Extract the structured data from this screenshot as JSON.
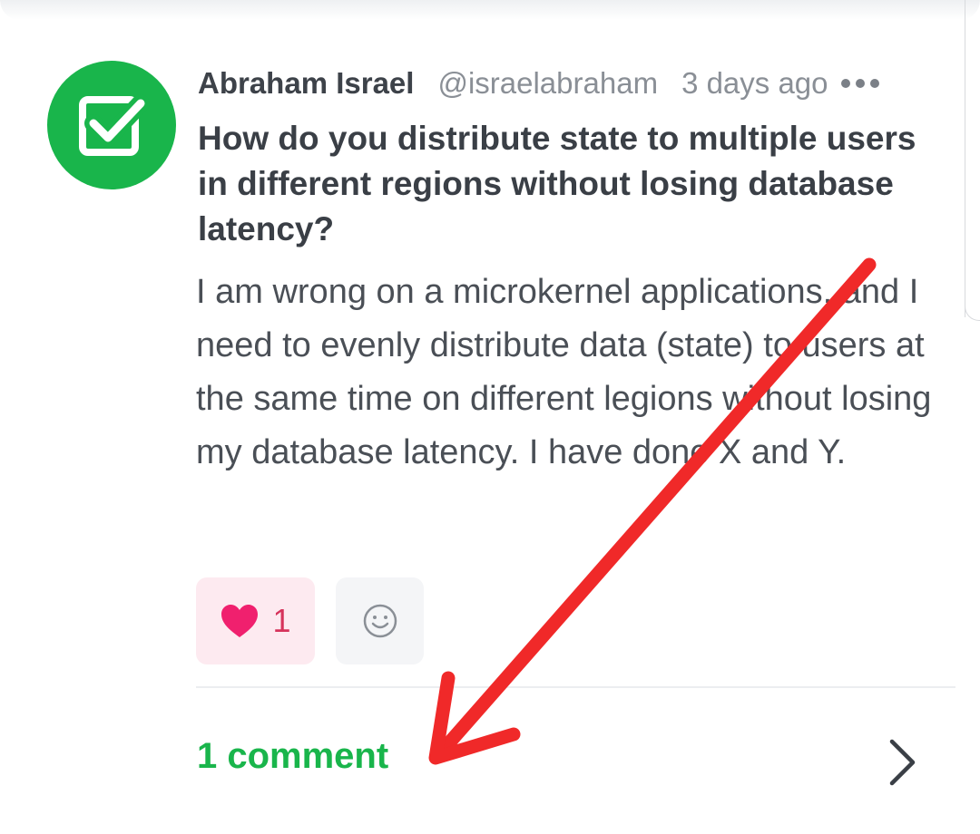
{
  "post": {
    "author_name": "Abraham Israel",
    "author_handle": "@israelabraham",
    "timestamp": "3 days ago",
    "title": "How do you distribute state to multiple users in different regions without losing database latency?",
    "body": "I am wrong on a microkernel applications, and I need to evenly distribute data (state) to users at the same time on different legions without losing my database latency. I have done X and Y.",
    "avatar_icon": "checkbox-check-icon",
    "avatar_color": "#19b54b"
  },
  "reactions": {
    "like_icon": "heart-icon",
    "like_count": "1",
    "add_reaction_icon": "smiley-icon"
  },
  "comments": {
    "label": "1 comment",
    "chevron_icon": "chevron-right-icon",
    "color": "#19b54b"
  },
  "annotation": {
    "arrow_color": "#f02929"
  }
}
